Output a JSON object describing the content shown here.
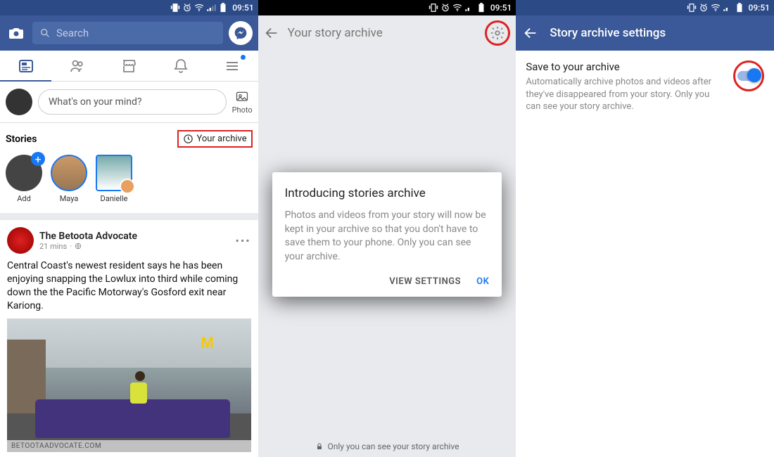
{
  "status": {
    "time": "09:51"
  },
  "panel1": {
    "search": {
      "placeholder": "Search"
    },
    "composer": {
      "placeholder": "What's on your mind?",
      "photo_label": "Photo"
    },
    "stories": {
      "title": "Stories",
      "archive_label": "Your archive",
      "items": [
        {
          "label": "Add"
        },
        {
          "label": "Maya"
        },
        {
          "label": "Danielle"
        }
      ]
    },
    "post": {
      "author": "The Betoota Advocate",
      "time": "21 mins",
      "body": "Central Coast's newest resident says he has been enjoying snapping the Lowlux into third while coming down the the Pacific Motorway's Gosford exit near Kariong.",
      "source": "BETOOTAADVOCATE.COM"
    }
  },
  "panel2": {
    "title": "Your story archive",
    "dialog": {
      "heading": "Introducing stories archive",
      "body": "Photos and videos from your story will now be kept in your archive so that you don't have to save them to your phone. Only you can see your archive.",
      "view_settings": "VIEW SETTINGS",
      "ok": "OK"
    },
    "footer_note": "Only you can see your story archive"
  },
  "panel3": {
    "title": "Story archive settings",
    "setting": {
      "label": "Save to your archive",
      "desc": "Automatically archive photos and videos after they've disappeared from your story. Only you can see your story archive."
    }
  }
}
